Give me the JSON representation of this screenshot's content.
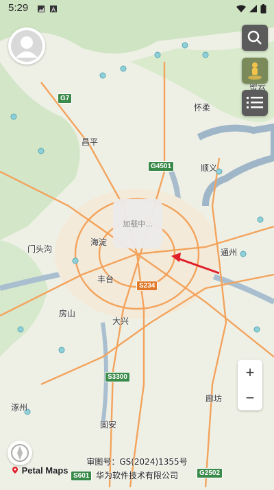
{
  "status_bar": {
    "time": "5:29"
  },
  "map": {
    "places": [
      "昌平",
      "怀柔",
      "顺义",
      "海淀",
      "门头沟",
      "丰台",
      "通州",
      "房山",
      "大兴",
      "涿州",
      "固安",
      "廊坊"
    ],
    "roads": [
      "G7",
      "G4501",
      "S234",
      "S3300",
      "S601",
      "G2502"
    ],
    "top_right_label": "密云"
  },
  "loading_text": "加载中...",
  "zoom": {
    "in": "+",
    "out": "−"
  },
  "brand": "Petal Maps",
  "copyright": {
    "line1": "审图号：GS(2024)1355号",
    "line2": "华为软件技术有限公司"
  },
  "icons": [
    "user-avatar-icon",
    "search-icon",
    "street-view-icon",
    "list-icon",
    "compass-icon",
    "pin-icon"
  ]
}
